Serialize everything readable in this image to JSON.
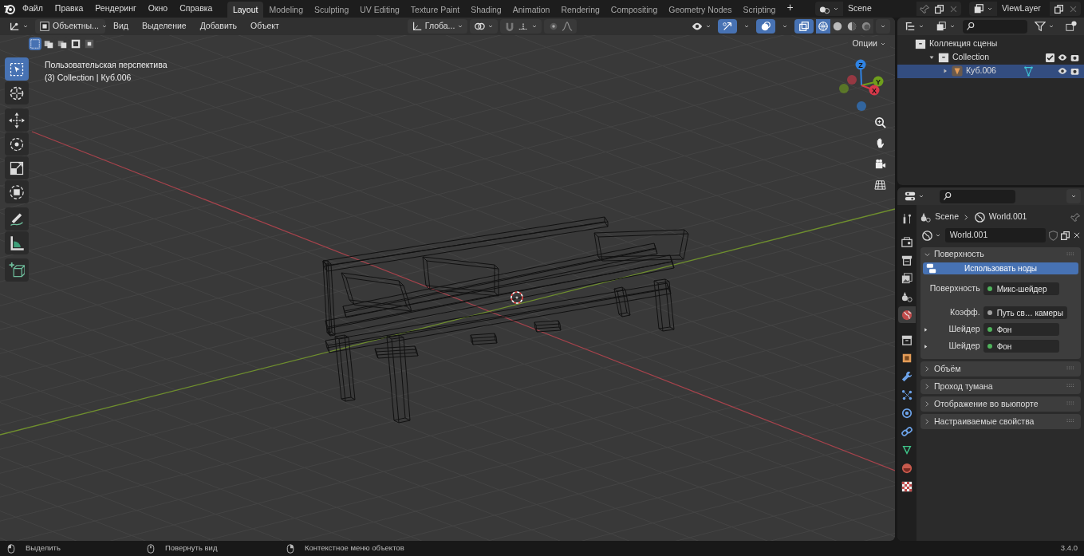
{
  "menu": [
    "Файл",
    "Правка",
    "Рендеринг",
    "Окно",
    "Справка"
  ],
  "workspaces": [
    {
      "label": "Layout",
      "selected": true
    },
    {
      "label": "Modeling",
      "selected": false
    },
    {
      "label": "Sculpting",
      "selected": false
    },
    {
      "label": "UV Editing",
      "selected": false
    },
    {
      "label": "Texture Paint",
      "selected": false
    },
    {
      "label": "Shading",
      "selected": false
    },
    {
      "label": "Animation",
      "selected": false
    },
    {
      "label": "Rendering",
      "selected": false
    },
    {
      "label": "Compositing",
      "selected": false
    },
    {
      "label": "Geometry Nodes",
      "selected": false
    },
    {
      "label": "Scripting",
      "selected": false
    }
  ],
  "add_workspace": "+",
  "scene": "Scene",
  "view_layer": "ViewLayer",
  "viewport": {
    "mode": "Объектны...",
    "menus": [
      "Вид",
      "Выделение",
      "Добавить",
      "Объект"
    ],
    "orientation": "Глоба...",
    "options": "Опции",
    "info": [
      "Пользовательская перспектива",
      "(3) Collection | Куб.006"
    ],
    "tools": [
      {
        "kind": "select",
        "selected": true
      },
      {
        "kind": "cursor",
        "selected": false
      },
      {
        "kind": "move",
        "selected": false
      },
      {
        "kind": "rotate",
        "selected": false
      },
      {
        "kind": "scale",
        "selected": false
      },
      {
        "kind": "transform",
        "selected": false
      },
      {
        "kind": "annotate",
        "selected": false
      },
      {
        "kind": "measure",
        "selected": false
      },
      {
        "kind": "add_cube",
        "selected": false
      }
    ],
    "gizmo": [
      {
        "label": "Z",
        "color": "#2f83e3"
      },
      {
        "label": "Y",
        "color": "#6f9f1c"
      },
      {
        "label": "X",
        "color": "#d6394a"
      }
    ]
  },
  "outliner": {
    "items": [
      {
        "label": "Коллекция сцены",
        "children": [
          {
            "label": "Collection",
            "checked": true,
            "expanded": true,
            "children": [
              {
                "label": "Куб.006",
                "selected": true,
                "expanded": false
              }
            ]
          }
        ]
      }
    ]
  },
  "properties": {
    "breadcrumb": [
      "Scene",
      "World.001"
    ],
    "world": "World.001",
    "tabs": [
      {
        "kind": "tool",
        "selected": false
      },
      {
        "kind": "render",
        "selected": false
      },
      {
        "kind": "output",
        "selected": false
      },
      {
        "kind": "view_layer",
        "selected": false
      },
      {
        "kind": "scene",
        "selected": false
      },
      {
        "kind": "world",
        "selected": true
      },
      {
        "kind": "collection",
        "selected": false
      },
      {
        "kind": "object",
        "selected": false
      },
      {
        "kind": "modifiers",
        "selected": false
      },
      {
        "kind": "particles",
        "selected": false
      },
      {
        "kind": "physics",
        "selected": false
      },
      {
        "kind": "constraints",
        "selected": false
      },
      {
        "kind": "data",
        "selected": false
      },
      {
        "kind": "material",
        "selected": false
      },
      {
        "kind": "texture",
        "selected": false
      }
    ],
    "panels": [
      {
        "title": "Поверхность",
        "expanded": true,
        "button": "Использовать ноды",
        "fields": [
          {
            "label": "Поверхность",
            "value": "Микс-шейдер",
            "color": "#4fb35b",
            "kind": "plain"
          },
          {
            "label": "Коэфф.",
            "value": "Путь св… камеры",
            "color": "#a0a0a0",
            "kind": "plain"
          },
          {
            "label": "Шейдер",
            "value": "Фон",
            "color": "#4fb35b",
            "kind": "expandable"
          },
          {
            "label": "Шейдер",
            "value": "Фон",
            "color": "#4fb35b",
            "kind": "expandable"
          }
        ]
      },
      {
        "title": "Объём",
        "expanded": false
      },
      {
        "title": "Проход тумана",
        "expanded": false
      },
      {
        "title": "Отображение во вьюпорте",
        "expanded": false
      },
      {
        "title": "Настраиваемые свойства",
        "expanded": false
      }
    ]
  },
  "status_bar": {
    "hints": [
      "Выделить",
      "Повернуть вид",
      "Контекстное меню объектов"
    ],
    "version": "3.4.0"
  }
}
